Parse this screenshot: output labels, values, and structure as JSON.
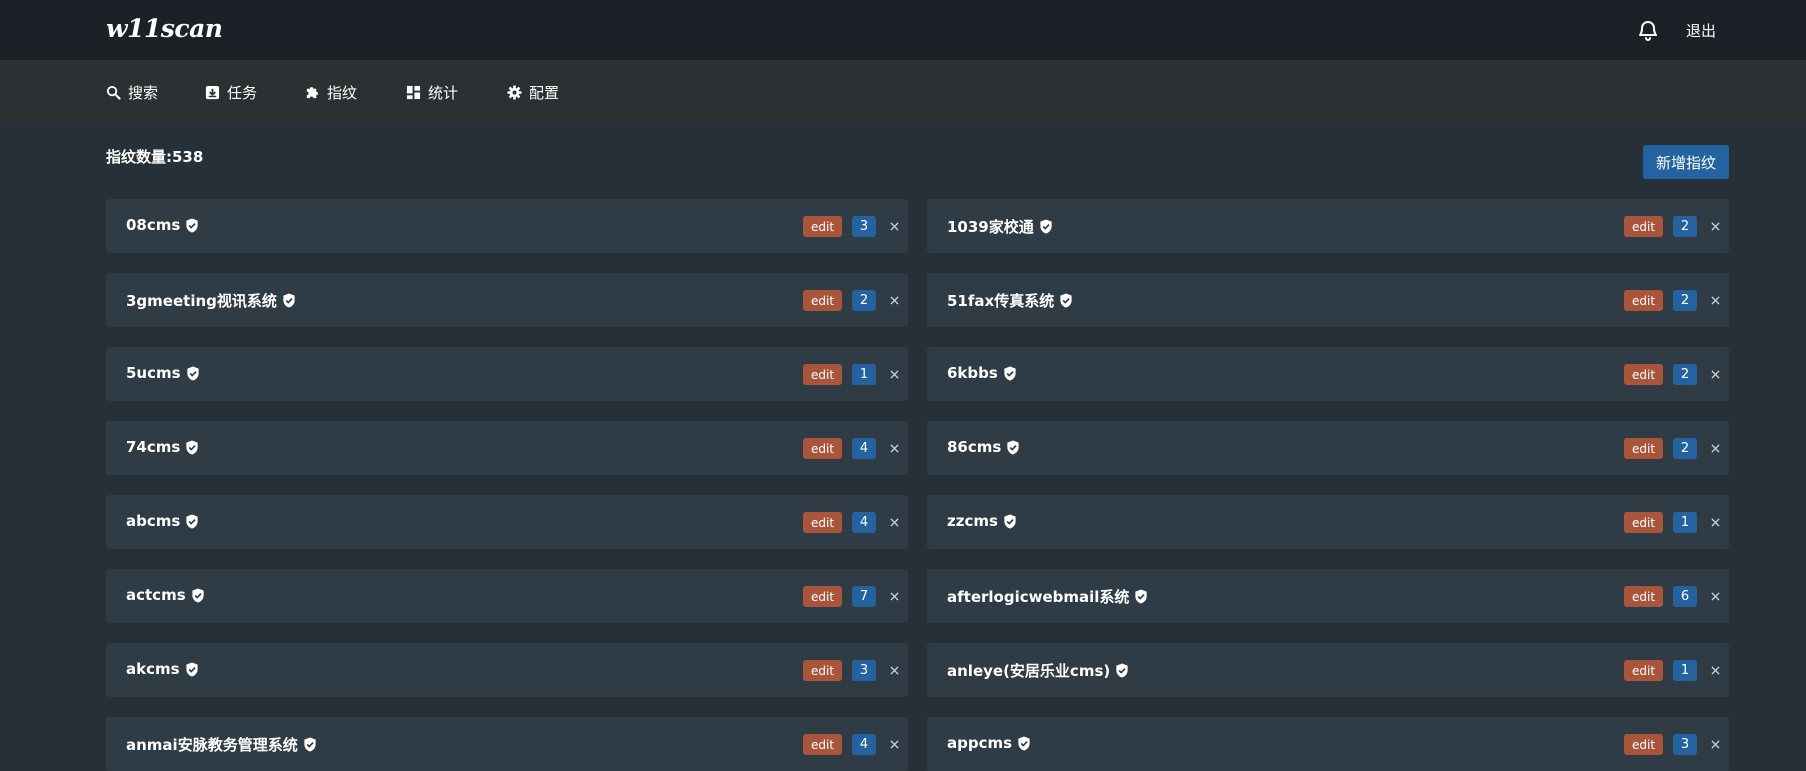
{
  "app": {
    "logo": "w11scan",
    "logout_label": "退出"
  },
  "nav": {
    "items": [
      {
        "label": "搜索",
        "icon": "search-icon"
      },
      {
        "label": "任务",
        "icon": "task-icon"
      },
      {
        "label": "指纹",
        "icon": "puzzle-icon"
      },
      {
        "label": "统计",
        "icon": "dashboard-icon"
      },
      {
        "label": "配置",
        "icon": "gear-icon"
      }
    ]
  },
  "main": {
    "count_label": "指纹数量:538",
    "add_button_label": "新增指纹",
    "edit_label": "edit",
    "fingerprints": [
      {
        "name": "08cms",
        "count": "3"
      },
      {
        "name": "1039家校通",
        "count": "2"
      },
      {
        "name": "3gmeeting视讯系统",
        "count": "2"
      },
      {
        "name": "51fax传真系统",
        "count": "2"
      },
      {
        "name": "5ucms",
        "count": "1"
      },
      {
        "name": "6kbbs",
        "count": "2"
      },
      {
        "name": "74cms",
        "count": "4"
      },
      {
        "name": "86cms",
        "count": "2"
      },
      {
        "name": "abcms",
        "count": "4"
      },
      {
        "name": "zzcms",
        "count": "1"
      },
      {
        "name": "actcms",
        "count": "7"
      },
      {
        "name": "afterlogicwebmail系统",
        "count": "6"
      },
      {
        "name": "akcms",
        "count": "3"
      },
      {
        "name": "anleye(安居乐业cms)",
        "count": "1"
      },
      {
        "name": "anmai安脉教务管理系统",
        "count": "4"
      },
      {
        "name": "appcms",
        "count": "3"
      }
    ]
  },
  "colors": {
    "topbar": "#1b2126",
    "navbar": "#2b3033",
    "background": "#253038",
    "card": "#2f3c45",
    "edit_tag": "#a9553b",
    "primary": "#2563a0"
  }
}
